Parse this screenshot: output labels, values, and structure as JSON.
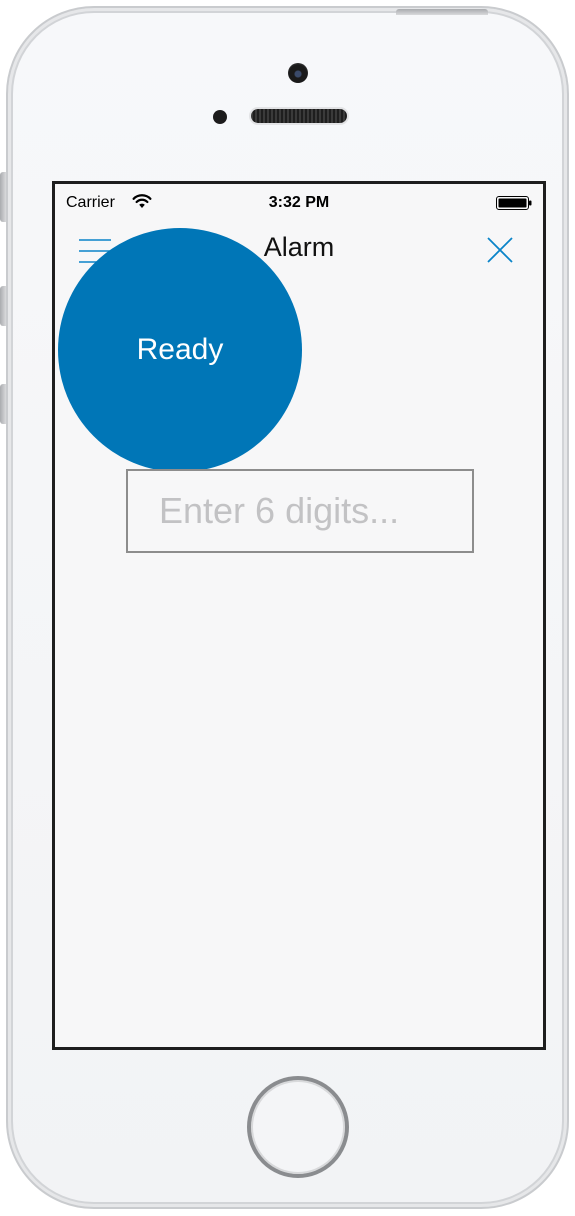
{
  "status_bar": {
    "carrier": "Carrier",
    "time": "3:32 PM",
    "wifi_icon": "wifi-icon",
    "battery_icon": "battery-icon"
  },
  "nav": {
    "title": "Alarm",
    "menu_icon": "hamburger-menu-icon",
    "close_icon": "close-icon"
  },
  "main": {
    "status_label": "Ready",
    "code_input": {
      "value": "",
      "placeholder": "Enter 6 digits..."
    }
  },
  "colors": {
    "accent": "#0076b7",
    "background": "#f7f7f8",
    "input_border": "#8d8d8d",
    "placeholder": "#c2c2c4"
  }
}
